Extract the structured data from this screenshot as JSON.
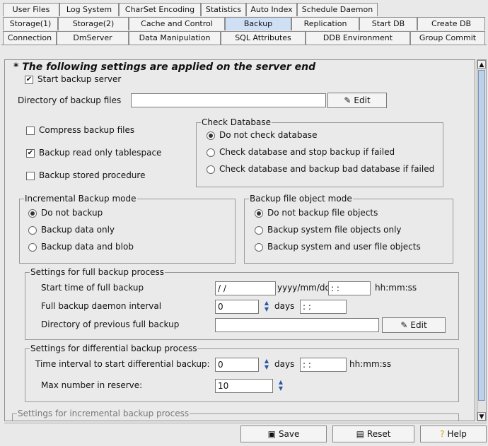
{
  "tabs_row1": [
    "User Files",
    "Log System",
    "CharSet Encoding",
    "Statistics",
    "Auto Index",
    "Schedule Daemon"
  ],
  "tabs_row2": [
    "Storage(1)",
    "Storage(2)",
    "Cache and Control",
    "Backup",
    "Replication",
    "Start DB",
    "Create DB"
  ],
  "tabs_row3": [
    "Connection",
    "DmServer",
    "Data Manipulation",
    "SQL Attributes",
    "DDB Environment",
    "Group Commit"
  ],
  "heading": "* The following settings are applied on the server end",
  "start_backup_server": "Start backup server",
  "dir_label": "Directory of backup files",
  "dir_value": "",
  "edit_label": "Edit",
  "compress": "Compress backup files",
  "readonly_ts": "Backup read only tablespace",
  "stored_proc": "Backup stored procedure",
  "check_db": {
    "title": "Check Database",
    "options": [
      "Do not check database",
      "Check database and stop backup if failed",
      "Check database and backup bad database if failed"
    ]
  },
  "incremental": {
    "title": "Incremental Backup mode",
    "options": [
      "Do not backup",
      "Backup data only",
      "Backup data and blob"
    ]
  },
  "file_object": {
    "title": "Backup file object mode",
    "options": [
      "Do not backup file objects",
      "Backup system file objects only",
      "Backup system and user file objects"
    ]
  },
  "full": {
    "title": "Settings for full backup process",
    "start_label": "Start time of full backup",
    "date_value": "  /  /",
    "date_fmt": "yyyy/mm/dd",
    "time_value": " :  :",
    "time_fmt": "hh:mm:ss",
    "interval_label": "Full backup daemon interval",
    "interval_value": "0",
    "days": "days",
    "interval_time": " :  :",
    "prev_label": "Directory of previous full backup",
    "prev_value": ""
  },
  "diff": {
    "title": "Settings for differential backup process",
    "interval_label": "Time interval to start differential backup:",
    "interval_value": "0",
    "days": "days",
    "time_value": " :  :",
    "time_fmt": "hh:mm:ss",
    "max_label": "Max number in reserve:",
    "max_value": "10"
  },
  "incr_settings_title": "Settings for incremental backup process",
  "buttons": {
    "save": "Save",
    "reset": "Reset",
    "help": "Help"
  }
}
